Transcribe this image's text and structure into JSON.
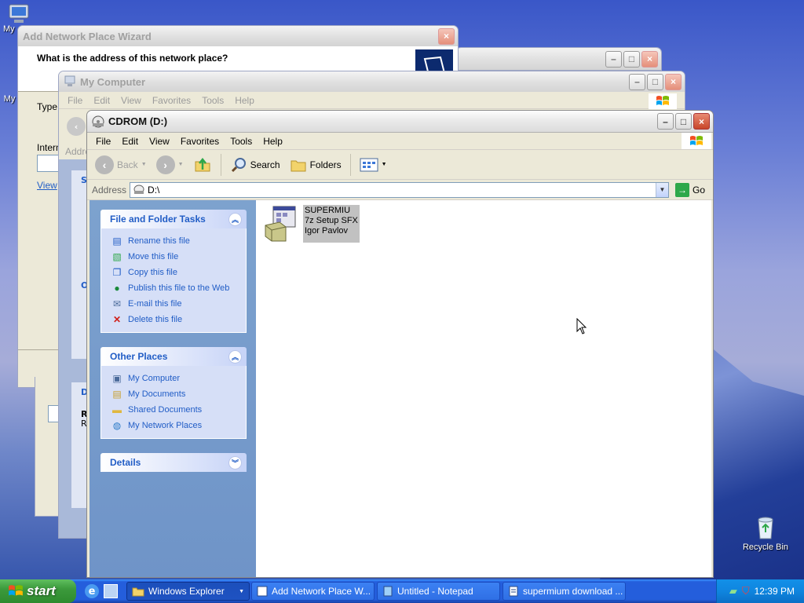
{
  "desktop": {
    "icons": [
      {
        "label": "My",
        "name": "my-computer-desktop-icon"
      },
      {
        "label": "My",
        "name": "my-documents-desktop-icon"
      }
    ],
    "recycle_bin_label": "Recycle Bin"
  },
  "wizard_window": {
    "title": "Add Network Place Wizard",
    "heading": "What is the address of this network place?",
    "type_label": "Type",
    "internet_label": "Intern",
    "view_link": "View"
  },
  "my_computer_window": {
    "title": "My Computer",
    "menu": [
      "File",
      "Edit",
      "View",
      "Favorites",
      "Tools",
      "Help"
    ],
    "address_label": "Addre",
    "panel_letters": [
      "S",
      "O",
      "D"
    ],
    "details_letters": [
      "R",
      "R"
    ]
  },
  "cdrom_window": {
    "title": "CDROM (D:)",
    "menu": [
      "File",
      "Edit",
      "View",
      "Favorites",
      "Tools",
      "Help"
    ],
    "toolbar": {
      "back": "Back",
      "search": "Search",
      "folders": "Folders"
    },
    "address": {
      "label": "Address",
      "value": "D:\\",
      "go": "Go"
    },
    "tasks_panel": {
      "title": "File and Folder Tasks",
      "items": [
        {
          "label": "Rename this file",
          "icon": "rename-icon"
        },
        {
          "label": "Move this file",
          "icon": "move-icon"
        },
        {
          "label": "Copy this file",
          "icon": "copy-icon"
        },
        {
          "label": "Publish this file to the Web",
          "icon": "globe-icon"
        },
        {
          "label": "E-mail this file",
          "icon": "email-icon"
        },
        {
          "label": "Delete this file",
          "icon": "delete-icon"
        }
      ]
    },
    "other_places": {
      "title": "Other Places",
      "items": [
        {
          "label": "My Computer",
          "icon": "computer-icon"
        },
        {
          "label": "My Documents",
          "icon": "documents-icon"
        },
        {
          "label": "Shared Documents",
          "icon": "folder-icon"
        },
        {
          "label": "My Network Places",
          "icon": "network-icon"
        }
      ]
    },
    "details_panel": {
      "title": "Details"
    },
    "file": {
      "line1": "SUPERMIU",
      "line2": "7z Setup SFX",
      "line3": "Igor Pavlov"
    }
  },
  "taskbar": {
    "start_label": "start",
    "buttons": [
      {
        "label": "Windows Explorer",
        "active": true
      },
      {
        "label": "Add Network Place W...",
        "active": false
      },
      {
        "label": "Untitled - Notepad",
        "active": false
      },
      {
        "label": "supermium download ...",
        "active": false
      }
    ],
    "clock": "12:39 PM"
  }
}
